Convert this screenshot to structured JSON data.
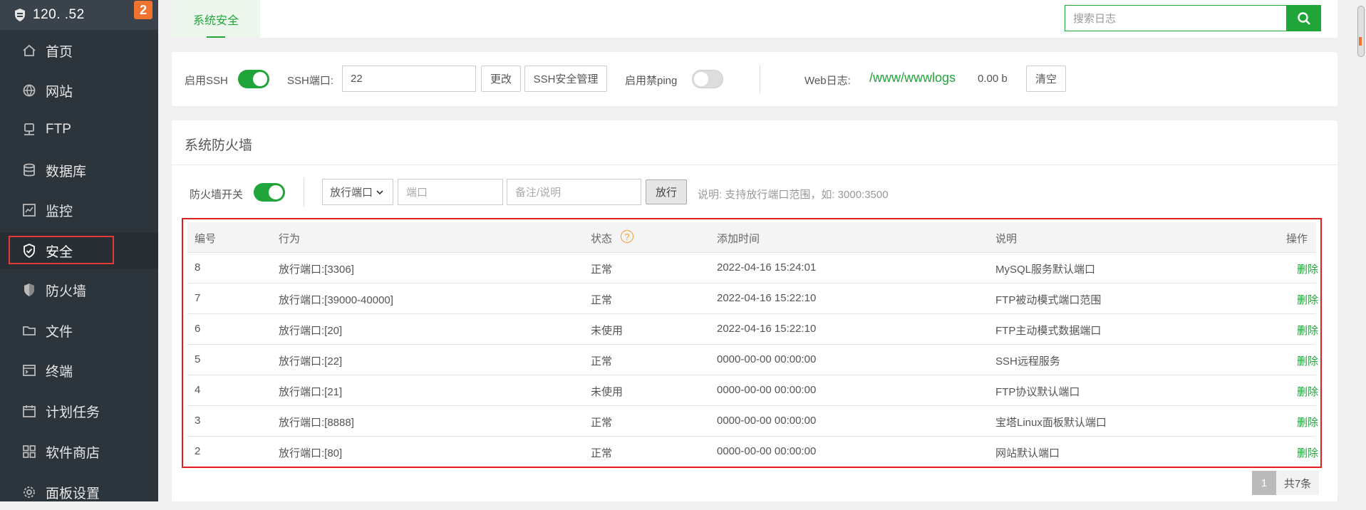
{
  "sidebar": {
    "server_ip": "120.    .52",
    "notification_count": "2",
    "items": [
      {
        "label": "首页",
        "icon": "home-icon"
      },
      {
        "label": "网站",
        "icon": "globe-icon"
      },
      {
        "label": "FTP",
        "icon": "ftp-icon"
      },
      {
        "label": "数据库",
        "icon": "database-icon"
      },
      {
        "label": "监控",
        "icon": "monitor-icon"
      },
      {
        "label": "安全",
        "icon": "shield-check-icon",
        "active": true
      },
      {
        "label": "防火墙",
        "icon": "shield-icon"
      },
      {
        "label": "文件",
        "icon": "folder-icon"
      },
      {
        "label": "终端",
        "icon": "terminal-icon"
      },
      {
        "label": "计划任务",
        "icon": "calendar-icon"
      },
      {
        "label": "软件商店",
        "icon": "grid-icon"
      },
      {
        "label": "面板设置",
        "icon": "gear-icon"
      }
    ]
  },
  "tabs": {
    "active": "系统安全"
  },
  "log_search": {
    "placeholder": "搜索日志"
  },
  "ssh": {
    "enable_label": "启用SSH",
    "enabled": true,
    "port_label": "SSH端口:",
    "port_value": "22",
    "change_button": "更改",
    "manage_button": "SSH安全管理",
    "ping_label": "启用禁ping",
    "ping_enabled": false
  },
  "weblog": {
    "label": "Web日志:",
    "path": "/www/wwwlogs",
    "size": "0.00 b",
    "clear_button": "清空"
  },
  "firewall": {
    "title": "系统防火墙",
    "switch_label": "防火墙开关",
    "enabled": true,
    "action_select": "放行端口",
    "port_placeholder": "端口",
    "note_placeholder": "备注/说明",
    "allow_button": "放行",
    "hint": "说明: 支持放行端口范围，如: 3000:3500",
    "columns": [
      "编号",
      "行为",
      "状态",
      "添加时间",
      "说明",
      "操作"
    ],
    "rows": [
      {
        "id": "8",
        "action": "放行端口:[3306]",
        "status": "正常",
        "time": "2022-04-16 15:24:01",
        "note": "MySQL服务默认端口",
        "op": "删除"
      },
      {
        "id": "7",
        "action": "放行端口:[39000-40000]",
        "status": "正常",
        "time": "2022-04-16 15:22:10",
        "note": "FTP被动模式端口范围",
        "op": "删除"
      },
      {
        "id": "6",
        "action": "放行端口:[20]",
        "status": "未使用",
        "time": "2022-04-16 15:22:10",
        "note": "FTP主动模式数据端口",
        "op": "删除"
      },
      {
        "id": "5",
        "action": "放行端口:[22]",
        "status": "正常",
        "time": "0000-00-00 00:00:00",
        "note": "SSH远程服务",
        "op": "删除"
      },
      {
        "id": "4",
        "action": "放行端口:[21]",
        "status": "未使用",
        "time": "0000-00-00 00:00:00",
        "note": "FTP协议默认端口",
        "op": "删除"
      },
      {
        "id": "3",
        "action": "放行端口:[8888]",
        "status": "正常",
        "time": "0000-00-00 00:00:00",
        "note": "宝塔Linux面板默认端口",
        "op": "删除"
      },
      {
        "id": "2",
        "action": "放行端口:[80]",
        "status": "正常",
        "time": "0000-00-00 00:00:00",
        "note": "网站默认端口",
        "op": "删除"
      }
    ],
    "pager": {
      "current": "1",
      "total": "共7条"
    }
  },
  "colors": {
    "accent": "#20a53a",
    "sidebar_bg": "#2d353c",
    "badge": "#f0732f",
    "highlight_border": "#e02020"
  }
}
